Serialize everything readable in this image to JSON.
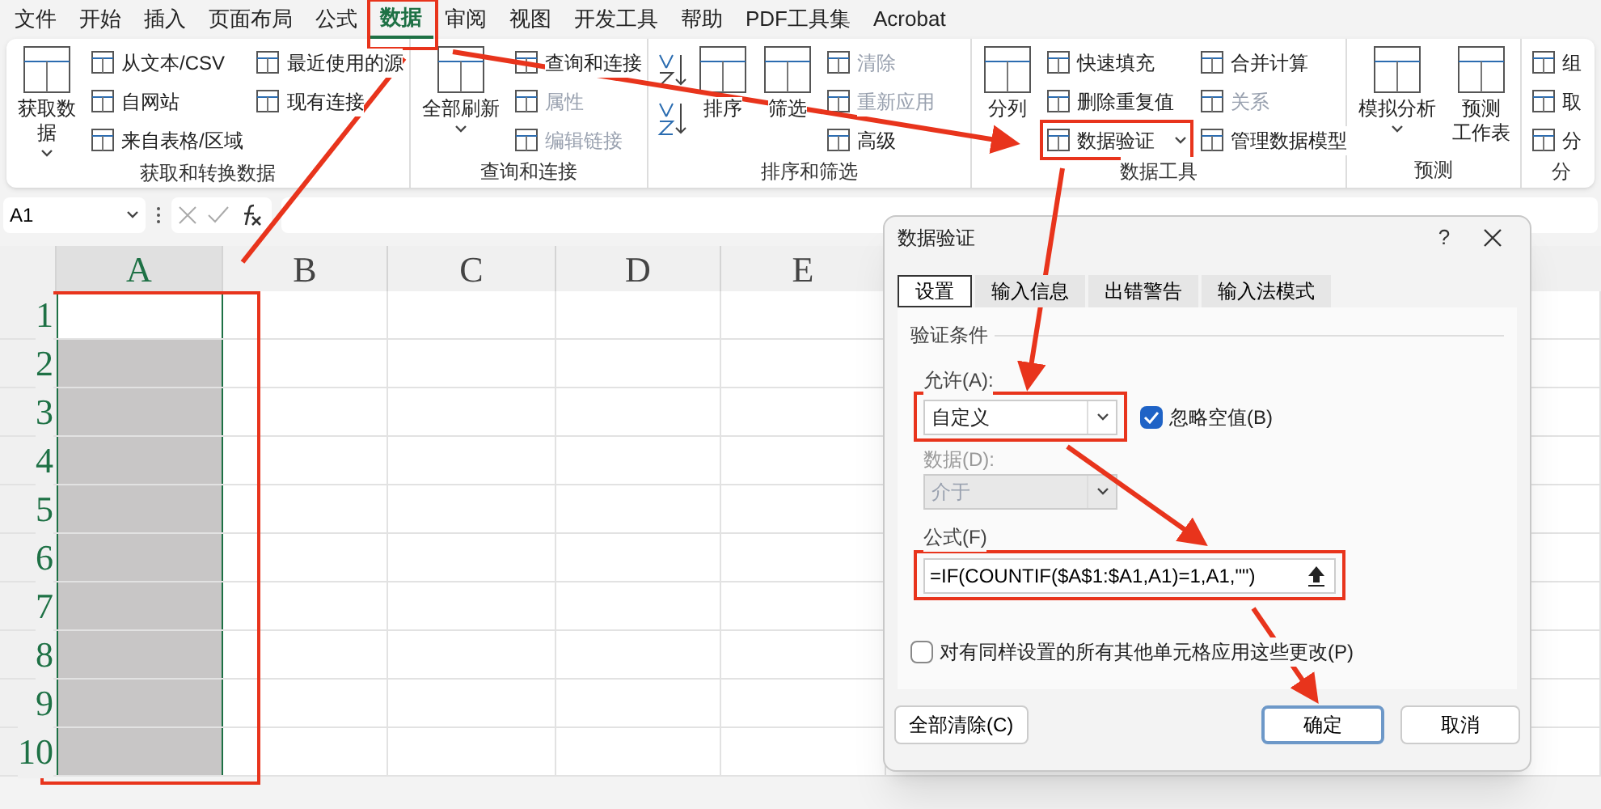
{
  "menu_tabs": [
    {
      "label": "文件",
      "selected": false
    },
    {
      "label": "开始",
      "selected": false
    },
    {
      "label": "插入",
      "selected": false
    },
    {
      "label": "页面布局",
      "selected": false
    },
    {
      "label": "公式",
      "selected": false
    },
    {
      "label": "数据",
      "selected": true
    },
    {
      "label": "审阅",
      "selected": false
    },
    {
      "label": "视图",
      "selected": false
    },
    {
      "label": "开发工具",
      "selected": false
    },
    {
      "label": "帮助",
      "selected": false
    },
    {
      "label": "PDF工具集",
      "selected": false
    },
    {
      "label": "Acrobat",
      "selected": false
    }
  ],
  "ribbon_groups": [
    {
      "label": "获取和转换数据",
      "buttons": [
        {
          "kind": "large",
          "lines": [
            "获取数",
            "据"
          ],
          "dropdown": true,
          "disabled": false
        },
        {
          "kind": "small",
          "label": "从文本/CSV",
          "disabled": false
        },
        {
          "kind": "small",
          "label": "自网站",
          "disabled": false
        },
        {
          "kind": "small",
          "label": "来自表格/区域",
          "disabled": false
        },
        {
          "kind": "small",
          "label": "最近使用的源",
          "disabled": false
        },
        {
          "kind": "small",
          "label": "现有连接",
          "disabled": false
        }
      ]
    },
    {
      "label": "查询和连接",
      "buttons": [
        {
          "kind": "large",
          "lines": [
            "全部刷新"
          ],
          "dropdown": true,
          "disabled": false
        },
        {
          "kind": "small",
          "label": "查询和连接",
          "disabled": false
        },
        {
          "kind": "small",
          "label": "属性",
          "disabled": true
        },
        {
          "kind": "small",
          "label": "编辑链接",
          "disabled": true
        }
      ]
    },
    {
      "label": "排序和筛选",
      "buttons": [
        {
          "kind": "sort_ascending"
        },
        {
          "kind": "sort_descending"
        },
        {
          "kind": "large",
          "lines": [
            "排序"
          ],
          "dropdown": false,
          "disabled": false
        },
        {
          "kind": "large",
          "lines": [
            "筛选"
          ],
          "dropdown": false,
          "disabled": false
        },
        {
          "kind": "small",
          "label": "清除",
          "disabled": true
        },
        {
          "kind": "small",
          "label": "重新应用",
          "disabled": true
        },
        {
          "kind": "small",
          "label": "高级",
          "disabled": false
        }
      ]
    },
    {
      "label": "数据工具",
      "buttons": [
        {
          "kind": "large",
          "lines": [
            "分列"
          ],
          "dropdown": false,
          "disabled": false
        },
        {
          "kind": "small",
          "label": "快速填充",
          "disabled": false
        },
        {
          "kind": "small",
          "label": "删除重复值",
          "disabled": false
        },
        {
          "kind": "small",
          "label": "数据验证",
          "dropdown": true,
          "highlighted": true,
          "disabled": false
        },
        {
          "kind": "small",
          "label": "合并计算",
          "disabled": false
        },
        {
          "kind": "small",
          "label": "关系",
          "disabled": true
        },
        {
          "kind": "small",
          "label": "管理数据模型",
          "disabled": false
        }
      ]
    },
    {
      "label": "预测",
      "buttons": [
        {
          "kind": "large",
          "lines": [
            "模拟分析"
          ],
          "dropdown": true,
          "disabled": false
        },
        {
          "kind": "large",
          "lines": [
            "预测",
            "工作表"
          ],
          "dropdown": false,
          "disabled": false
        }
      ]
    },
    {
      "label": "分",
      "buttons": [
        {
          "kind": "small",
          "label": "组",
          "disabled": false
        },
        {
          "kind": "small",
          "label": "取",
          "disabled": false
        },
        {
          "kind": "small",
          "label": "分",
          "disabled": false
        }
      ]
    }
  ],
  "formula_bar": {
    "name_box": "A1"
  },
  "sheet": {
    "columns": [
      {
        "label": "A",
        "selected": true
      },
      {
        "label": "B",
        "selected": false
      },
      {
        "label": "C",
        "selected": false
      },
      {
        "label": "D",
        "selected": false
      },
      {
        "label": "E",
        "selected": false
      }
    ],
    "rows": [
      {
        "label": "1",
        "a_shaded": false
      },
      {
        "label": "2",
        "a_shaded": true
      },
      {
        "label": "3",
        "a_shaded": true
      },
      {
        "label": "4",
        "a_shaded": true
      },
      {
        "label": "5",
        "a_shaded": true
      },
      {
        "label": "6",
        "a_shaded": true
      },
      {
        "label": "7",
        "a_shaded": true
      },
      {
        "label": "8",
        "a_shaded": true
      },
      {
        "label": "9",
        "a_shaded": true
      },
      {
        "label": "10",
        "a_shaded": true
      }
    ]
  },
  "dialog": {
    "title": "数据验证",
    "help": "?",
    "tabs": [
      {
        "label": "设置",
        "selected": true
      },
      {
        "label": "输入信息",
        "selected": false
      },
      {
        "label": "出错警告",
        "selected": false
      },
      {
        "label": "输入法模式",
        "selected": false
      }
    ],
    "section": "验证条件",
    "allow_label": "允许(A):",
    "allow_value": "自定义",
    "ignore_blank": {
      "label": "忽略空值(B)",
      "checked": true
    },
    "data_label": "数据(D):",
    "data_value": "介于",
    "data_disabled": true,
    "formula_label": "公式(F)",
    "formula_value": "=IF(COUNTIF($A$1:$A1,A1)=1,A1,\"\")",
    "apply_all": {
      "label": "对有同样设置的所有其他单元格应用这些更改(P)",
      "checked": false
    },
    "buttons": [
      {
        "label": "全部清除(C)",
        "default": false
      },
      {
        "label": "确定",
        "default": true
      },
      {
        "label": "取消",
        "default": false
      }
    ]
  }
}
